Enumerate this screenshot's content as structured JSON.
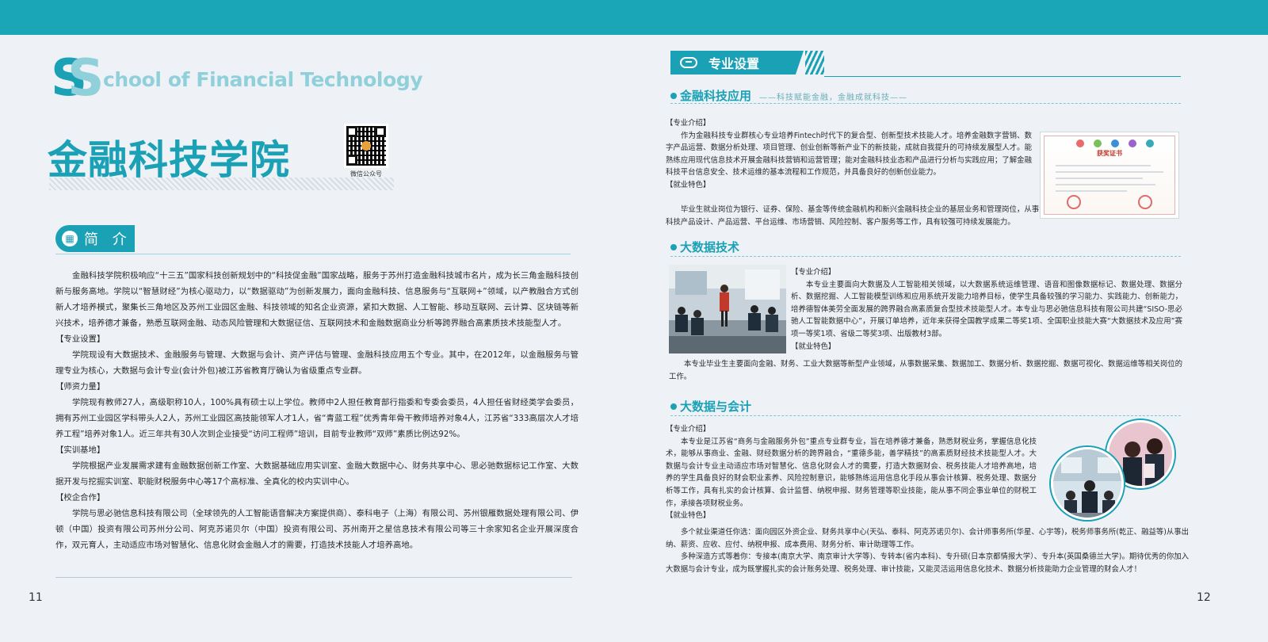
{
  "left": {
    "logo_letters": "SS",
    "logo_text": "chool of Financial Technology",
    "title": "金融科技学院",
    "qr_caption": "微信公众号",
    "intro_heading": "简 介",
    "paragraphs": [
      {
        "text": "金融科技学院积极响应“十三五”国家科技创新规划中的“科技促金融”国家战略，服务于苏州打造金融科技城市名片，成为长三角金融科技创新与服务高地。学院以“智慧财经”为核心驱动力，以“数据驱动”为创新发展力，面向金融科技、信息服务与“互联网+”领域，以产教融合方式创新人才培养模式，聚集长三角地区及苏州工业园区金融、科技领域的知名企业资源，紧扣大数据、人工智能、移动互联网、云计算、区块链等新兴技术，培养德才兼备，熟悉互联网金融、动态风险管理和大数据征信、互联网技术和金融数据商业分析等跨界融合高素质技术技能型人才。"
      },
      {
        "heading": "【专业设置】",
        "text": "学院现设有大数据技术、金融服务与管理、大数据与会计、资产评估与管理、金融科技应用五个专业。其中，在2012年，以金融服务与管理专业为核心，大数据与会计专业(会计外包)被江苏省教育厅确认为省级重点专业群。"
      },
      {
        "heading": "【师资力量】",
        "text": "学院现有教师27人，高级职称10人，100%具有硕士以上学位。教师中2人担任教育部行指委和专委会委员，4人担任省财经类学会委员，拥有苏州工业园区学科带头人2人，苏州工业园区高技能领军人才1人，省“青蓝工程”优秀青年骨干教师培养对象4人，江苏省“333高层次人才培养工程”培养对象1人。近三年共有30人次到企业接受“访问工程师”培训，目前专业教师“双师”素质比例达92%。"
      },
      {
        "heading": "【实训基地】",
        "text": "学院根据产业发展需求建有金融数据创新工作室、大数据基础应用实训室、金融大数据中心、财务共享中心、思必驰数据标记工作室、大数据开发与挖掘实训室、职能财税服务中心等17个高标准、全真化的校内实训中心。"
      },
      {
        "heading": "【校企合作】",
        "text": "学院与思必驰信息科技有限公司（全球领先的人工智能语音解决方案提供商）、泰科电子（上海）有限公司、苏州银雁数据处理有限公司、伊顿（中国）投资有限公司苏州分公司、阿克苏诺贝尔（中国）投资有限公司、苏州南开之星信息技术有限公司等三十余家知名企业开展深度合作，双元育人，主动适应市场对智慧化、信息化财会金融人才的需要，打造技术技能人才培养高地。"
      }
    ],
    "page_number": "11"
  },
  "right": {
    "section_title": "专业设置",
    "majors": [
      {
        "name": "金融科技应用",
        "tagline": "——科技赋能金融，金融成就科技——",
        "intro_label": "【专业介绍】",
        "intro": "作为金融科技专业群核心专业培养Fintech时代下的复合型、创新型技术技能人才。培养金融数字营销、数字产品运营、数据分析处理、项目管理、创业创新等新产业下的新技能，成就自我提升的可持续发展型人才。能熟练应用现代信息技术开展金融科技营销和运营管理；能对金融科技业态和产品进行分析与实践应用；了解金融科技平台信息安全、技术运维的基本流程和工作规范，并具备良好的创新创业能力。",
        "career_label": "【就业特色】",
        "career": "毕业生就业岗位为银行、证券、保险、基金等传统金融机构和新兴金融科技企业的基层业务和管理岗位，从事金融科技产品设计、产品运营、平台运维、市场营销、风险控制、客户服务等工作，具有较强可持续发展能力。",
        "cert_title": "获奖证书"
      },
      {
        "name": "大数据技术",
        "intro_label": "【专业介绍】",
        "intro": "本专业主要面向大数据及人工智能相关领域，以大数据系统运维管理、语音和图像数据标记、数据处理、数据分析、数据挖掘、人工智能模型训练和应用系统开发能力培养目标，使学生具备较强的学习能力、实践能力、创新能力，培养德智体美劳全面发展的跨界融合高素质复合型技术技能型人才。本专业与思必驰信息科技有限公司共建“SISO-思必驰人工智能数据中心”，开展订单培养，近年来获得全国教学成果二等奖1项、全国职业技能大赛“大数据技术及应用”赛项一等奖1项、省级二等奖3项、出版教材3部。",
        "career_label": "【就业特色】",
        "career": "本专业毕业生主要面向金融、财务、工业大数据等新型产业领域，从事数据采集、数据加工、数据分析、数据挖掘、数据可视化、数据运维等相关岗位的工作。"
      },
      {
        "name": "大数据与会计",
        "intro_label": "【专业介绍】",
        "intro": "本专业是江苏省“商务与金融服务外包”重点专业群专业，旨在培养德才兼备，熟悉财税业务，掌握信息化技术，能够从事商业、金融、财经数据分析的跨界融合，“重德多能，善学精技”的高素质财经技术技能型人才。大数据与会计专业主动适应市场对智慧化、信息化财会人才的需要，打造大数据财会、税务技能人才培养高地，培养的学生具备良好的财会职业素养、风险控制意识，能够熟练运用信息化手段从事会计核算、税务处理、数据分析等工作，具有扎实的会计核算、会计监督、纳税申报、财务管理等职业技能，能从事不同企事业单位的财税工作，承接各项财税业务。",
        "career_label": "【就业特色】",
        "career": "多个就业渠道任你选：面向园区外资企业、财务共享中心(天弘、泰科、阿克苏诺贝尔)、会计师事务所(华星、心宇等)，税务师事务所(乾正、融益等)从事出纳、薪资、应收、应付、纳税申报、成本费用、财务分析、审计助理等工作。",
        "career2": "多种深造方式等着你：专接本(南京大学、南京审计大学等)、专转本(省内本科)、专升硕(日本京都情报大学）、专升本(英国桑德兰大学)。期待优秀的你加入大数据与会计专业，成为既掌握扎实的会计账务处理、税务处理、审计技能，又能灵活运用信息化技术、数据分析技能助力企业管理的财会人才！"
      }
    ],
    "page_number": "12"
  },
  "colors": {
    "accent": "#1aa1b5",
    "accent_light": "#8fd0da",
    "background": "#eef2f6"
  },
  "icons": {
    "intro": "book-icon",
    "section": "pen-icon"
  }
}
